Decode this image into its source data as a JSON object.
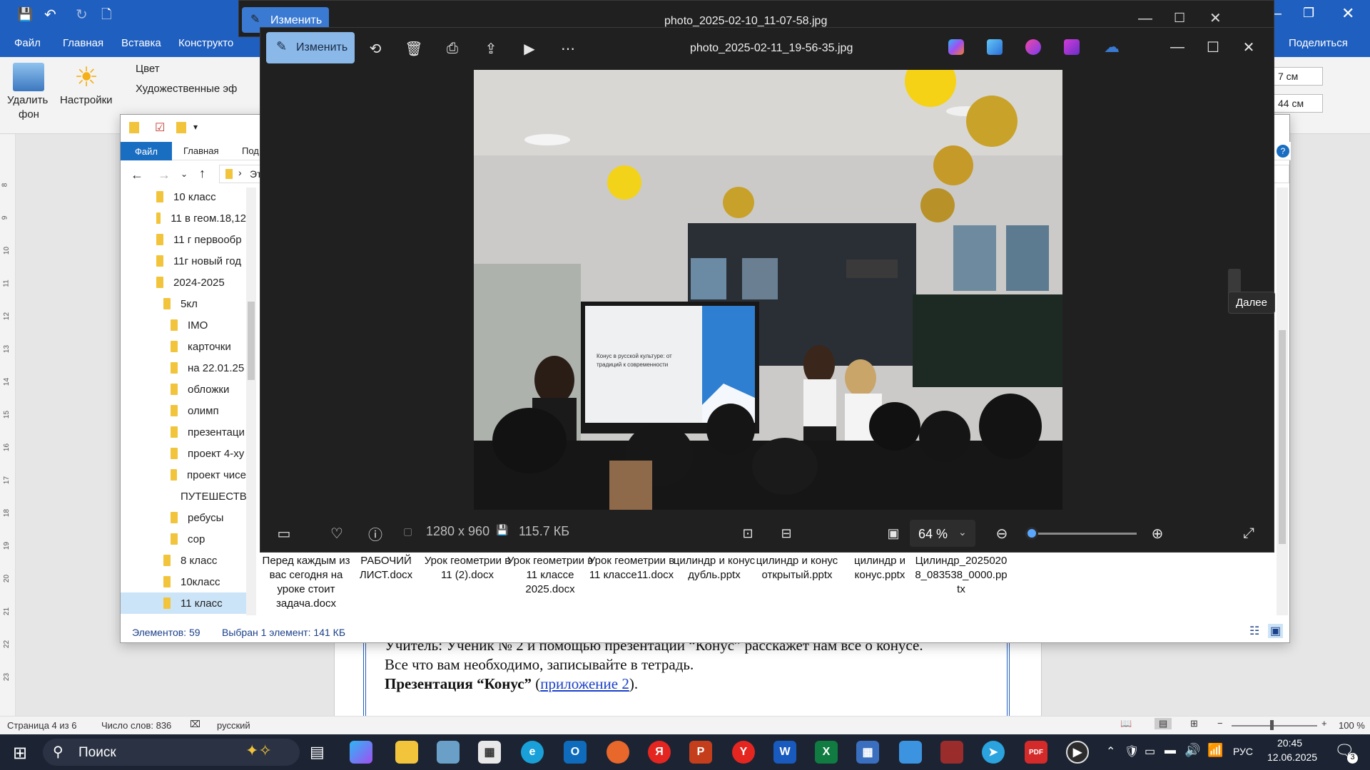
{
  "word": {
    "tabs": [
      "Файл",
      "Главная",
      "Вставка",
      "Конструкто"
    ],
    "share_label": "Поделиться",
    "ribbon": {
      "remove_bg_line1": "Удалить",
      "remove_bg_line2": "фон",
      "adjust_label": "Настройки",
      "color_label": "Цвет",
      "art_effects_label": "Художественные эф",
      "height_value": "7 см",
      "width_value": "44 см"
    },
    "doc_text": {
      "line1": "Учитель: Ученик № 2 и помощью презентации “Конус” расскажет нам все о конусе.",
      "line2": "Все что вам необходимо, записывайте в тетрадь.",
      "line3_bold": "Презентация “Конус”",
      "line3_open": " (",
      "line3_link": "приложение 2",
      "line3_close": ")."
    },
    "status": {
      "page": "Страница 4 из 6",
      "words": "Число слов: 836",
      "lang": "русский",
      "zoom": "100 %"
    },
    "ruler_numbers": [
      "8",
      "9",
      "10",
      "11",
      "12",
      "13",
      "14",
      "15",
      "16",
      "17",
      "18",
      "19",
      "20",
      "21",
      "22",
      "23"
    ]
  },
  "explorer": {
    "menu": [
      "Файл",
      "Главная",
      "Под"
    ],
    "address": "Эт",
    "tree": [
      {
        "label": "10 класс",
        "level": 0
      },
      {
        "label": "11 в геом.18,12",
        "level": 0
      },
      {
        "label": "11 г первообр",
        "level": 0
      },
      {
        "label": "11г новый год",
        "level": 0
      },
      {
        "label": "2024-2025",
        "level": 0
      },
      {
        "label": "5кл",
        "level": 1
      },
      {
        "label": "IMO",
        "level": 2
      },
      {
        "label": "карточки",
        "level": 2
      },
      {
        "label": "на 22.01.25",
        "level": 2
      },
      {
        "label": "обложки",
        "level": 2
      },
      {
        "label": "олимп",
        "level": 2
      },
      {
        "label": "презентаци",
        "level": 2
      },
      {
        "label": "проект 4-ху",
        "level": 2
      },
      {
        "label": "проект чисе",
        "level": 2
      },
      {
        "label": "ПУТЕШЕСТВ",
        "level": 2
      },
      {
        "label": "ребусы",
        "level": 2
      },
      {
        "label": "сор",
        "level": 2
      },
      {
        "label": "8 класс",
        "level": 1
      },
      {
        "label": "10класс",
        "level": 1
      },
      {
        "label": "11 класс",
        "level": 1
      }
    ],
    "files": [
      "Перед каждым из вас сегодня на уроке стоит задача.docx",
      "РАБОЧИЙ ЛИСТ.docx",
      "Урок геометрии в 11 (2).docx",
      "Урок геометрии в 11 классе 2025.docx",
      "Урок геометрии в 11 классе11.docx",
      "цилиндр и конус дубль.pptx",
      "цилиндр и конус открытый.pptx",
      "цилиндр и конус.pptx",
      "Цилиндр_20250208_083538_0000.pptx"
    ],
    "status_count": "Элементов: 59",
    "status_selected": "Выбран 1 элемент: 141 КБ"
  },
  "photos_back": {
    "edit_label": "Изменить",
    "filename": "photo_2025-02-10_11-07-58.jpg"
  },
  "photos": {
    "edit_label": "Изменить",
    "filename": "photo_2025-02-11_19-56-35.jpg",
    "next_tooltip": "Далее",
    "dimensions": "1280 x 960",
    "filesize": "115.7 КБ",
    "zoom": "64 %",
    "zoom_level": 0.06,
    "slide_title": "Конус в русской культуре: от традиций к современности"
  },
  "taskbar": {
    "search_label": "Поиск",
    "lang": "РУС",
    "time": "20:45",
    "date": "12.06.2025",
    "notifications": "3"
  }
}
